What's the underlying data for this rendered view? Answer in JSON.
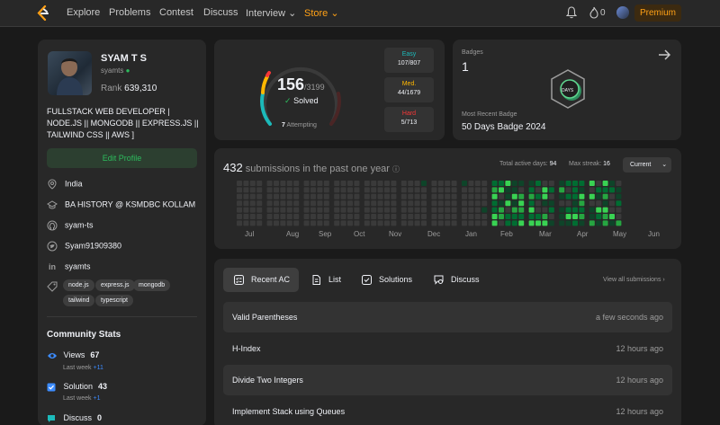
{
  "nav": {
    "items": [
      "Explore",
      "Problems",
      "Contest",
      "Discuss",
      "Interview",
      "Store"
    ],
    "streak_count": "0",
    "premium_label": "Premium"
  },
  "profile": {
    "name": "SYAM T S",
    "handle": "syamts",
    "rank_label": "Rank",
    "rank_value": "639,310",
    "bio": "FULLSTACK WEB DEVELOPER | NODE.JS || MONGODB || EXPRESS.JS || TAILWIND CSS || AWS ]",
    "edit_label": "Edit Profile",
    "info": [
      {
        "icon": "location-icon",
        "text": "India"
      },
      {
        "icon": "school-icon",
        "text": "BA HISTORY @ KSMDBC KOLLAM"
      },
      {
        "icon": "github-icon",
        "text": "syam-ts"
      },
      {
        "icon": "twitter-icon",
        "text": "Syam91909380"
      },
      {
        "icon": "linkedin-icon",
        "text": "syamts"
      }
    ],
    "skills": [
      "node.js",
      "express.js",
      "mongodb",
      "tailwind",
      "typescript"
    ],
    "stats_title": "Community Stats",
    "stats": [
      {
        "icon": "eye-icon",
        "label": "Views",
        "value": "67",
        "sub_label": "Last week",
        "sub_value": "+11"
      },
      {
        "icon": "solution-icon",
        "label": "Solution",
        "value": "43",
        "sub_label": "Last week",
        "sub_value": "+1"
      },
      {
        "icon": "discuss-icon",
        "label": "Discuss",
        "value": "0"
      }
    ]
  },
  "solved": {
    "count": "156",
    "total": "/3199",
    "label": "Solved",
    "attempting_count": "7",
    "attempting_label": "Attempting",
    "difficulties": [
      {
        "label": "Easy",
        "value": "107/807",
        "color": "#1cbaba"
      },
      {
        "label": "Med.",
        "value": "44/1679",
        "color": "#ffb700"
      },
      {
        "label": "Hard",
        "value": "5/713",
        "color": "#f63737"
      }
    ]
  },
  "badges": {
    "label": "Badges",
    "count": "1",
    "recent_label": "Most Recent Badge",
    "recent_name": "50 Days Badge 2024",
    "badge_text": "DAYS"
  },
  "submissions": {
    "count": "432",
    "title_text": "submissions in the past one year",
    "active_days_label": "Total active days:",
    "active_days": "94",
    "max_streak_label": "Max streak:",
    "max_streak": "16",
    "current_label": "Current",
    "months": [
      "Jul",
      "Aug",
      "Sep",
      "Oct",
      "Nov",
      "Dec",
      "Jan",
      "Feb",
      "Mar",
      "Apr",
      "May",
      "Jun"
    ]
  },
  "recent": {
    "tabs": [
      "Recent AC",
      "List",
      "Solutions",
      "Discuss"
    ],
    "view_all": "View all submissions",
    "rows": [
      {
        "title": "Valid Parentheses",
        "time": "a few seconds ago"
      },
      {
        "title": "H-Index",
        "time": "12 hours ago"
      },
      {
        "title": "Divide Two Integers",
        "time": "12 hours ago"
      },
      {
        "title": "Implement Stack using Queues",
        "time": "12 hours ago"
      }
    ]
  },
  "colors": {
    "accent": "#ffa116",
    "green": "#2cbb5d",
    "easy": "#1cbaba",
    "medium": "#ffb700",
    "hard": "#f63737"
  }
}
